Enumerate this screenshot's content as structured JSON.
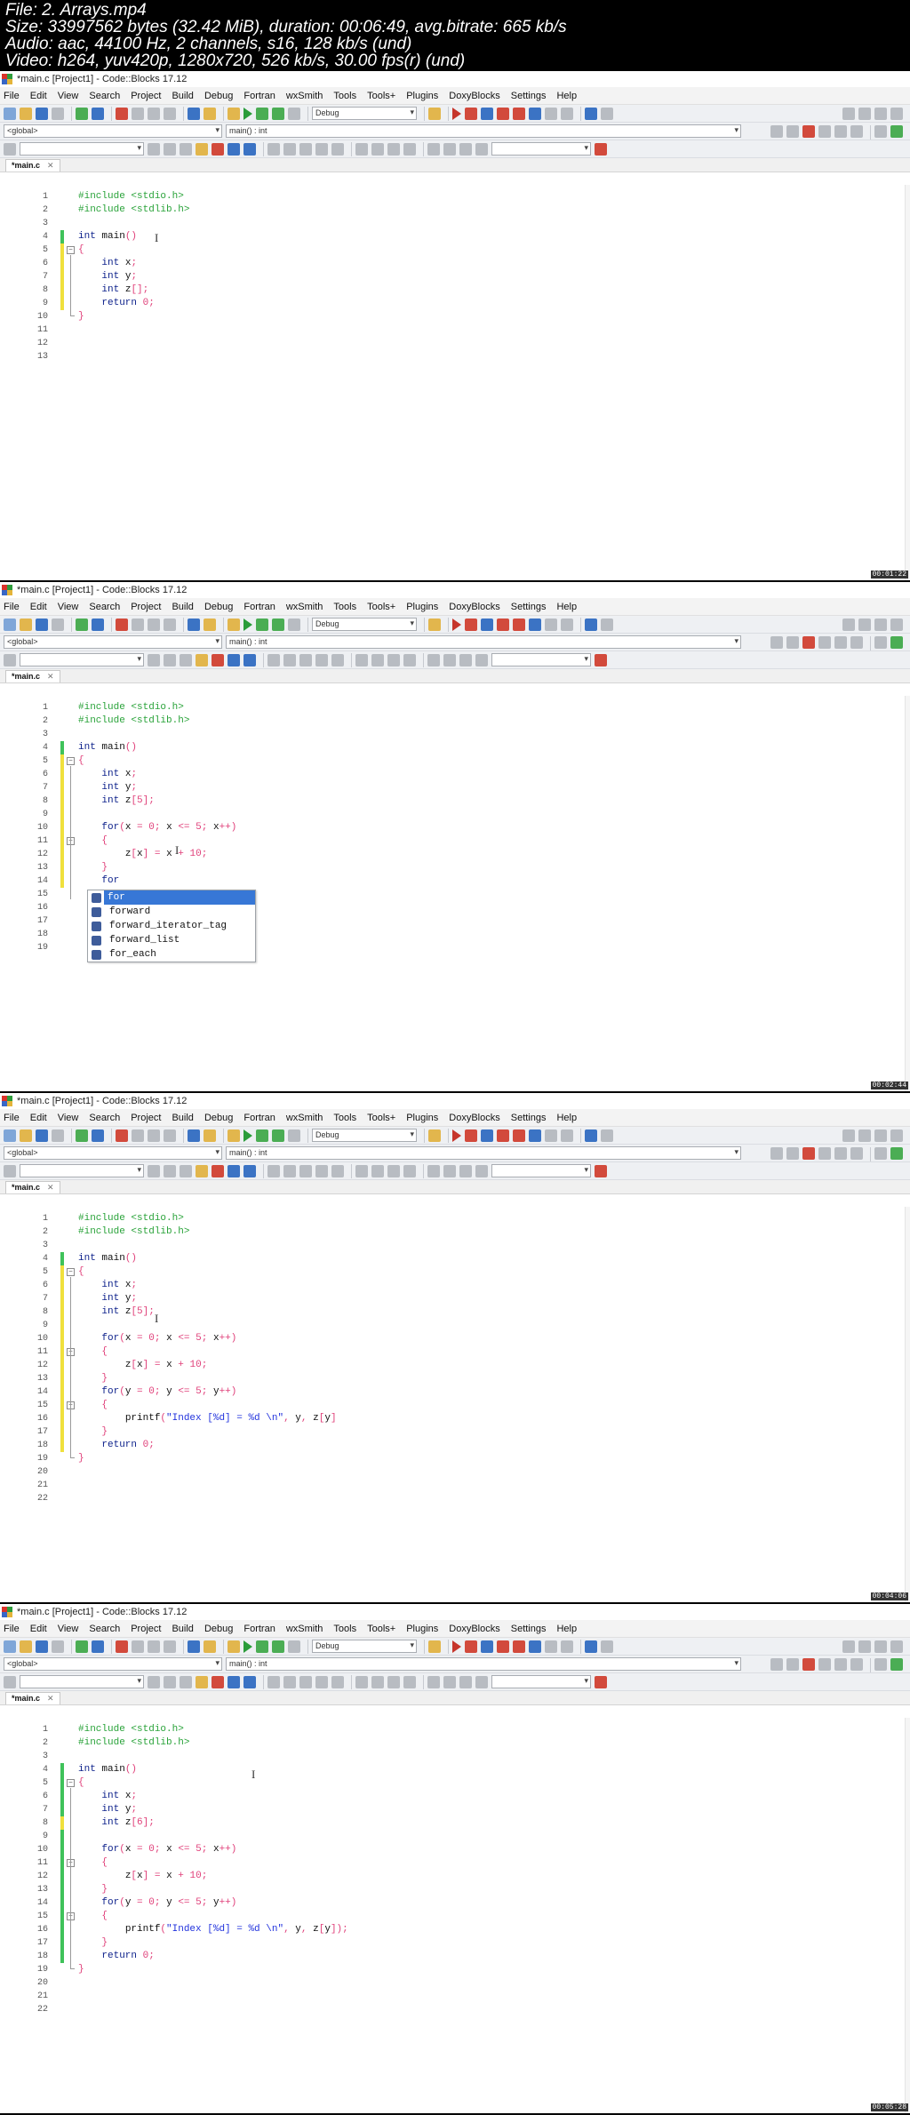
{
  "header": {
    "file": "File: 2. Arrays.mp4",
    "size": "Size: 33997562 bytes (32.42 MiB), duration: 00:06:49, avg.bitrate: 665 kb/s",
    "audio": "Audio: aac, 44100 Hz, 2 channels, s16, 128 kb/s (und)",
    "video": "Video: h264, yuv420p, 1280x720, 526 kb/s, 30.00 fps(r) (und)"
  },
  "window": {
    "title": "*main.c [Project1] - Code::Blocks 17.12",
    "menu": [
      "File",
      "Edit",
      "View",
      "Search",
      "Project",
      "Build",
      "Debug",
      "Fortran",
      "wxSmith",
      "Tools",
      "Tools+",
      "Plugins",
      "DoxyBlocks",
      "Settings",
      "Help"
    ],
    "build_target": "Debug",
    "scope": "<global>",
    "function": "main() : int",
    "tab_label": "*main.c"
  },
  "frames": [
    {
      "timestamp": "00:01:22",
      "lines": [
        {
          "n": "1",
          "code": "#include <stdio.h>"
        },
        {
          "n": "2",
          "code": "#include <stdlib.h>"
        },
        {
          "n": "3",
          "code": ""
        },
        {
          "n": "4",
          "code": "int main()"
        },
        {
          "n": "5",
          "code": "{"
        },
        {
          "n": "6",
          "code": "    int x;"
        },
        {
          "n": "7",
          "code": "    int y;"
        },
        {
          "n": "8",
          "code": "    int z[];"
        },
        {
          "n": "9",
          "code": "    return 0;"
        },
        {
          "n": "10",
          "code": "}"
        },
        {
          "n": "11",
          "code": ""
        },
        {
          "n": "12",
          "code": ""
        },
        {
          "n": "13",
          "code": ""
        }
      ]
    },
    {
      "timestamp": "00:02:44",
      "lines": [
        {
          "n": "1",
          "code": "#include <stdio.h>"
        },
        {
          "n": "2",
          "code": "#include <stdlib.h>"
        },
        {
          "n": "3",
          "code": ""
        },
        {
          "n": "4",
          "code": "int main()"
        },
        {
          "n": "5",
          "code": "{"
        },
        {
          "n": "6",
          "code": "    int x;"
        },
        {
          "n": "7",
          "code": "    int y;"
        },
        {
          "n": "8",
          "code": "    int z[5];"
        },
        {
          "n": "9",
          "code": ""
        },
        {
          "n": "10",
          "code": "    for(x = 0; x <= 5; x++)"
        },
        {
          "n": "11",
          "code": "    {"
        },
        {
          "n": "12",
          "code": "        z[x] = x + 10;"
        },
        {
          "n": "13",
          "code": "    }"
        },
        {
          "n": "14",
          "code": "    for"
        },
        {
          "n": "15",
          "code": ""
        },
        {
          "n": "16",
          "code": ""
        },
        {
          "n": "17",
          "code": ""
        },
        {
          "n": "18",
          "code": ""
        },
        {
          "n": "19",
          "code": ""
        }
      ],
      "autocomplete": [
        "for",
        "forward",
        "forward_iterator_tag",
        "forward_list",
        "for_each"
      ]
    },
    {
      "timestamp": "00:04:06",
      "lines": [
        {
          "n": "1",
          "code": "#include <stdio.h>"
        },
        {
          "n": "2",
          "code": "#include <stdlib.h>"
        },
        {
          "n": "3",
          "code": ""
        },
        {
          "n": "4",
          "code": "int main()"
        },
        {
          "n": "5",
          "code": "{"
        },
        {
          "n": "6",
          "code": "    int x;"
        },
        {
          "n": "7",
          "code": "    int y;"
        },
        {
          "n": "8",
          "code": "    int z[5];"
        },
        {
          "n": "9",
          "code": ""
        },
        {
          "n": "10",
          "code": "    for(x = 0; x <= 5; x++)"
        },
        {
          "n": "11",
          "code": "    {"
        },
        {
          "n": "12",
          "code": "        z[x] = x + 10;"
        },
        {
          "n": "13",
          "code": "    }"
        },
        {
          "n": "14",
          "code": "    for(y = 0; y <= 5; y++)"
        },
        {
          "n": "15",
          "code": "    {"
        },
        {
          "n": "16",
          "code": "        printf(\"Index [%d] = %d \\n\", y, z[y]"
        },
        {
          "n": "17",
          "code": "    }"
        },
        {
          "n": "18",
          "code": "    return 0;"
        },
        {
          "n": "19",
          "code": "}"
        },
        {
          "n": "20",
          "code": ""
        },
        {
          "n": "21",
          "code": ""
        },
        {
          "n": "22",
          "code": ""
        }
      ]
    },
    {
      "timestamp": "00:05:28",
      "lines": [
        {
          "n": "1",
          "code": "#include <stdio.h>"
        },
        {
          "n": "2",
          "code": "#include <stdlib.h>"
        },
        {
          "n": "3",
          "code": ""
        },
        {
          "n": "4",
          "code": "int main()"
        },
        {
          "n": "5",
          "code": "{"
        },
        {
          "n": "6",
          "code": "    int x;"
        },
        {
          "n": "7",
          "code": "    int y;"
        },
        {
          "n": "8",
          "code": "    int z[6];"
        },
        {
          "n": "9",
          "code": ""
        },
        {
          "n": "10",
          "code": "    for(x = 0; x <= 5; x++)"
        },
        {
          "n": "11",
          "code": "    {"
        },
        {
          "n": "12",
          "code": "        z[x] = x + 10;"
        },
        {
          "n": "13",
          "code": "    }"
        },
        {
          "n": "14",
          "code": "    for(y = 0; y <= 5; y++)"
        },
        {
          "n": "15",
          "code": "    {"
        },
        {
          "n": "16",
          "code": "        printf(\"Index [%d] = %d \\n\", y, z[y]);"
        },
        {
          "n": "17",
          "code": "    }"
        },
        {
          "n": "18",
          "code": "    return 0;"
        },
        {
          "n": "19",
          "code": "}"
        },
        {
          "n": "20",
          "code": ""
        },
        {
          "n": "21",
          "code": ""
        },
        {
          "n": "22",
          "code": ""
        }
      ]
    }
  ]
}
